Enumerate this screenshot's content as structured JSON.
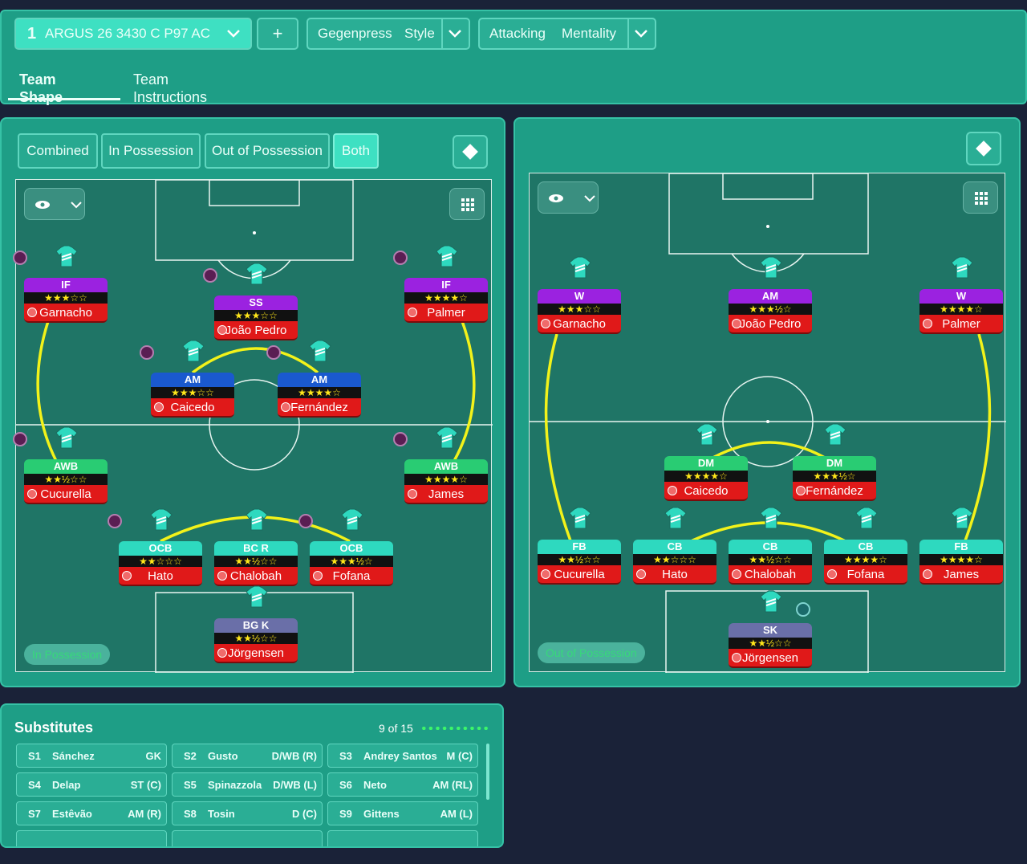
{
  "header": {
    "formation_number": "1",
    "tactic_name": "ARGUS 26 3430 C P97 AC",
    "add_label": "+",
    "style_value": "Gegenpress",
    "style_label": "Style",
    "mentality_value": "Attacking",
    "mentality_label": "Mentality"
  },
  "tabs": [
    {
      "label": "Team Shape",
      "active": true
    },
    {
      "label": "Team Instructions",
      "active": false
    }
  ],
  "view_toggle": {
    "options": [
      "Combined",
      "In Possession",
      "Out of Possession",
      "Both"
    ],
    "selected": "Both"
  },
  "left_pitch": {
    "phase_label": "In Possession",
    "players": [
      {
        "role": "IF",
        "role_color": "purple",
        "stars": "★★★☆☆",
        "name": "Garnacho"
      },
      {
        "role": "SS",
        "role_color": "purple",
        "stars": "★★★☆☆",
        "name": "João Pedro"
      },
      {
        "role": "IF",
        "role_color": "purple",
        "stars": "★★★★☆",
        "name": "Palmer"
      },
      {
        "role": "AM",
        "role_color": "blue",
        "stars": "★★★☆☆",
        "name": "Caicedo"
      },
      {
        "role": "AM",
        "role_color": "blue",
        "stars": "★★★★☆",
        "name": "Fernández"
      },
      {
        "role": "AWB",
        "role_color": "green",
        "stars": "★★½☆☆",
        "name": "Cucurella"
      },
      {
        "role": "AWB",
        "role_color": "green",
        "stars": "★★★★☆",
        "name": "James"
      },
      {
        "role": "OCB",
        "role_color": "teal",
        "stars": "★★☆☆☆",
        "name": "Hato"
      },
      {
        "role": "BC R",
        "role_color": "teal",
        "stars": "★★½☆☆",
        "name": "Chalobah"
      },
      {
        "role": "OCB",
        "role_color": "teal",
        "stars": "★★★½☆",
        "name": "Fofana"
      },
      {
        "role": "BG K",
        "role_color": "slate",
        "stars": "★★½☆☆",
        "name": "Jörgensen"
      }
    ]
  },
  "right_pitch": {
    "phase_label": "Out of Possession",
    "players": [
      {
        "role": "W",
        "role_color": "purple",
        "stars": "★★★☆☆",
        "name": "Garnacho"
      },
      {
        "role": "AM",
        "role_color": "purple",
        "stars": "★★★½☆",
        "name": "João Pedro"
      },
      {
        "role": "W",
        "role_color": "purple",
        "stars": "★★★★☆",
        "name": "Palmer"
      },
      {
        "role": "DM",
        "role_color": "green",
        "stars": "★★★★☆",
        "name": "Caicedo"
      },
      {
        "role": "DM",
        "role_color": "green",
        "stars": "★★★½☆",
        "name": "Fernández"
      },
      {
        "role": "FB",
        "role_color": "teal",
        "stars": "★★½☆☆",
        "name": "Cucurella"
      },
      {
        "role": "CB",
        "role_color": "teal",
        "stars": "★★☆☆☆",
        "name": "Hato"
      },
      {
        "role": "CB",
        "role_color": "teal",
        "stars": "★★½☆☆",
        "name": "Chalobah"
      },
      {
        "role": "CB",
        "role_color": "teal",
        "stars": "★★★★☆",
        "name": "Fofana"
      },
      {
        "role": "FB",
        "role_color": "teal",
        "stars": "★★★★☆",
        "name": "James"
      },
      {
        "role": "SK",
        "role_color": "slate",
        "stars": "★★½☆☆",
        "name": "Jörgensen"
      }
    ]
  },
  "substitutes": {
    "title": "Substitutes",
    "count_label": "9 of 15",
    "list": [
      {
        "slot": "S1",
        "name": "Sánchez",
        "pos": "GK"
      },
      {
        "slot": "S2",
        "name": "Gusto",
        "pos": "D/WB (R)"
      },
      {
        "slot": "S3",
        "name": "Andrey Santos",
        "pos": "M (C)"
      },
      {
        "slot": "S4",
        "name": "Delap",
        "pos": "ST (C)"
      },
      {
        "slot": "S5",
        "name": "Spinazzola",
        "pos": "D/WB (L)"
      },
      {
        "slot": "S6",
        "name": "Neto",
        "pos": "AM (RL)"
      },
      {
        "slot": "S7",
        "name": "Estêvão",
        "pos": "AM (R)"
      },
      {
        "slot": "S8",
        "name": "Tosin",
        "pos": "D (C)"
      },
      {
        "slot": "S9",
        "name": "Gittens",
        "pos": "AM (L)"
      }
    ]
  },
  "colors": {
    "panel": "#1e9e86",
    "pitch": "#1f7566",
    "link_line": "#f2f21a",
    "name_bar": "#e01919",
    "role_purple": "#9b22e0",
    "role_blue": "#1a59cf",
    "role_green": "#29cc73",
    "role_teal": "#2ed9bf",
    "role_slate": "#6a6fa8"
  }
}
